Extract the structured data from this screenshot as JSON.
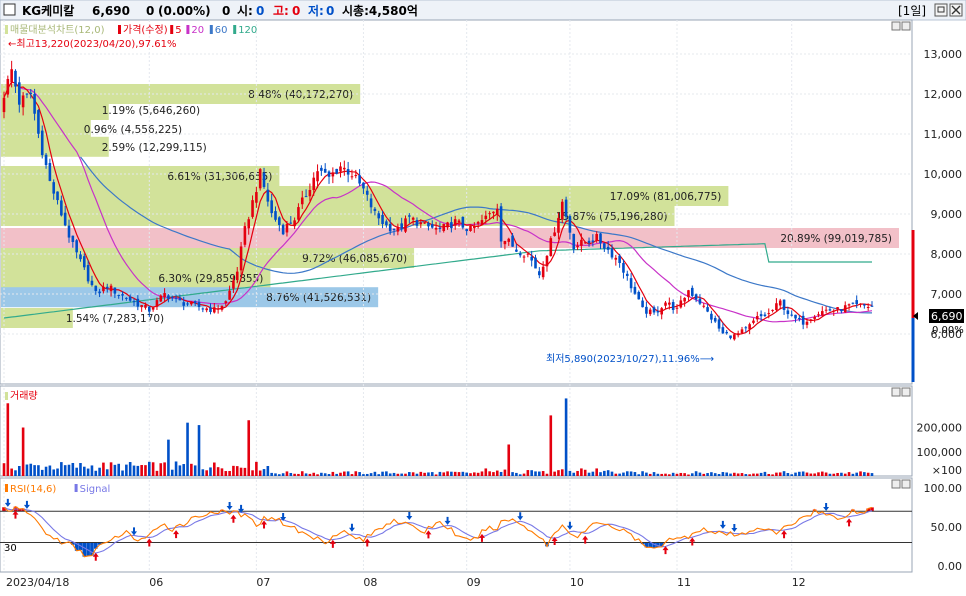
{
  "header": {
    "name": "KG케미칼",
    "price": "6,690",
    "change": "0",
    "change_pct": "(0.00%)",
    "volume": "0",
    "open_label": "시:",
    "open_val": "0",
    "high_label": "고:",
    "high_val": "0",
    "low_label": "저:",
    "low_val": "0",
    "mcap": "시총:4,580억",
    "period": "[1일]"
  },
  "colors": {
    "up": "#e4000f",
    "down": "#0050c8",
    "ma5": "#e4000f",
    "ma20": "#c832c8",
    "ma60": "#3c78c8",
    "ma120": "#32aa8c",
    "rsi": "#ff7a00",
    "signal": "#7878e6",
    "band_green": "#d2e29a",
    "band_pink": "#f2c0c8",
    "band_blue": "#9cc8e8"
  },
  "legends": {
    "price": [
      {
        "text": "매물대분석차트(12,0)",
        "color": "#d2e29a"
      },
      {
        "text": "가격(수정)",
        "color": "#e4000f"
      },
      {
        "text": "5",
        "color": "#e4000f"
      },
      {
        "text": "20",
        "color": "#c832c8"
      },
      {
        "text": "60",
        "color": "#3c78c8"
      },
      {
        "text": "120",
        "color": "#32aa8c"
      }
    ],
    "volume": "거래량",
    "rsi": [
      {
        "text": "RSI(14,6)",
        "color": "#ff7a00"
      },
      {
        "text": "Signal",
        "color": "#7878e6"
      }
    ]
  },
  "annotations": {
    "high": "최고13,220(2023/04/20),97.61%",
    "low": "최저5,890(2023/10/27),11.96%",
    "rsi_level": "30",
    "current_price": "6,690",
    "current_pct": "0.00%"
  },
  "chart_data": [
    {
      "type": "candlestick",
      "title": "",
      "ylim": [
        4800,
        13800
      ],
      "y_ticks": [
        "13,000",
        "12,000",
        "11,000",
        "10,000",
        "9,000",
        "8,000",
        "7,000",
        "6,000"
      ],
      "x_tick_labels": [
        "2023/04/18",
        "06",
        "07",
        "08",
        "09",
        "10",
        "11",
        "12"
      ],
      "ohlc_anchors": [
        [
          0,
          12000
        ],
        [
          2,
          12600
        ],
        [
          4,
          11800
        ],
        [
          7,
          12000
        ],
        [
          9,
          11000
        ],
        [
          12,
          9800
        ],
        [
          15,
          9000
        ],
        [
          18,
          8200
        ],
        [
          21,
          7600
        ],
        [
          24,
          7000
        ],
        [
          27,
          7200
        ],
        [
          30,
          7000
        ],
        [
          34,
          6800
        ],
        [
          38,
          6600
        ],
        [
          42,
          7000
        ],
        [
          46,
          6800
        ],
        [
          50,
          6700
        ],
        [
          55,
          6600
        ],
        [
          58,
          6800
        ],
        [
          61,
          7600
        ],
        [
          63,
          8600
        ],
        [
          65,
          9300
        ],
        [
          67,
          10000
        ],
        [
          70,
          9000
        ],
        [
          73,
          8600
        ],
        [
          76,
          8900
        ],
        [
          79,
          9500
        ],
        [
          82,
          10100
        ],
        [
          85,
          9900
        ],
        [
          88,
          10200
        ],
        [
          91,
          10000
        ],
        [
          94,
          9600
        ],
        [
          97,
          9000
        ],
        [
          100,
          8700
        ],
        [
          103,
          8600
        ],
        [
          106,
          8900
        ],
        [
          110,
          8700
        ],
        [
          114,
          8600
        ],
        [
          118,
          8800
        ],
        [
          122,
          8600
        ],
        [
          126,
          8900
        ],
        [
          129,
          9200
        ],
        [
          130,
          8400
        ],
        [
          132,
          8300
        ],
        [
          134,
          8100
        ],
        [
          137,
          8000
        ],
        [
          140,
          7500
        ],
        [
          143,
          8300
        ],
        [
          146,
          9300
        ],
        [
          149,
          8200
        ],
        [
          152,
          8300
        ],
        [
          155,
          8400
        ],
        [
          158,
          8100
        ],
        [
          161,
          7800
        ],
        [
          164,
          7200
        ],
        [
          167,
          6600
        ],
        [
          170,
          6500
        ],
        [
          173,
          6800
        ],
        [
          176,
          6600
        ],
        [
          179,
          7100
        ],
        [
          182,
          6800
        ],
        [
          185,
          6400
        ],
        [
          188,
          6000
        ],
        [
          191,
          5950
        ],
        [
          194,
          6100
        ],
        [
          197,
          6400
        ],
        [
          200,
          6500
        ],
        [
          203,
          6800
        ],
        [
          206,
          6400
        ],
        [
          209,
          6300
        ],
        [
          212,
          6500
        ],
        [
          215,
          6600
        ],
        [
          218,
          6600
        ],
        [
          221,
          6700
        ],
        [
          224,
          6700
        ],
        [
          227,
          6690
        ]
      ],
      "volume_ticks": [
        "200,000",
        "100,000",
        "×100"
      ],
      "volume_notable_spikes": [
        [
          1,
          300000
        ],
        [
          5,
          200000
        ],
        [
          43,
          150000
        ],
        [
          48,
          220000
        ],
        [
          51,
          210000
        ],
        [
          64,
          230000
        ],
        [
          132,
          130000
        ],
        [
          143,
          250000
        ],
        [
          147,
          320000
        ]
      ],
      "rsi_ticks": [
        "100.00",
        "50.00",
        "0.00"
      ],
      "rsi_anchors": [
        [
          0,
          74
        ],
        [
          3,
          72
        ],
        [
          6,
          70
        ],
        [
          8,
          60
        ],
        [
          10,
          48
        ],
        [
          12,
          38
        ],
        [
          14,
          33
        ],
        [
          16,
          30
        ],
        [
          18,
          25
        ],
        [
          20,
          17
        ],
        [
          22,
          12
        ],
        [
          24,
          22
        ],
        [
          26,
          28
        ],
        [
          28,
          30
        ],
        [
          30,
          40
        ],
        [
          32,
          42
        ],
        [
          34,
          36
        ],
        [
          36,
          34
        ],
        [
          38,
          40
        ],
        [
          40,
          45
        ],
        [
          42,
          52
        ],
        [
          44,
          48
        ],
        [
          46,
          53
        ],
        [
          48,
          57
        ],
        [
          50,
          62
        ],
        [
          52,
          66
        ],
        [
          54,
          69
        ],
        [
          56,
          70
        ],
        [
          58,
          66
        ],
        [
          60,
          70
        ],
        [
          62,
          66
        ],
        [
          64,
          60
        ],
        [
          66,
          54
        ],
        [
          68,
          60
        ],
        [
          70,
          64
        ],
        [
          72,
          58
        ],
        [
          74,
          53
        ],
        [
          76,
          48
        ],
        [
          78,
          42
        ],
        [
          80,
          38
        ],
        [
          82,
          35
        ],
        [
          84,
          32
        ],
        [
          86,
          38
        ],
        [
          88,
          46
        ],
        [
          90,
          40
        ],
        [
          92,
          36
        ],
        [
          94,
          34
        ],
        [
          96,
          40
        ],
        [
          98,
          48
        ],
        [
          100,
          54
        ],
        [
          102,
          60
        ],
        [
          104,
          56
        ],
        [
          106,
          50
        ],
        [
          108,
          48
        ],
        [
          110,
          44
        ],
        [
          112,
          52
        ],
        [
          114,
          56
        ],
        [
          116,
          50
        ],
        [
          118,
          42
        ],
        [
          120,
          34
        ],
        [
          122,
          30
        ],
        [
          124,
          38
        ],
        [
          126,
          48
        ],
        [
          128,
          46
        ],
        [
          130,
          55
        ],
        [
          132,
          60
        ],
        [
          134,
          57
        ],
        [
          136,
          51
        ],
        [
          138,
          46
        ],
        [
          140,
          37
        ],
        [
          142,
          28
        ],
        [
          144,
          42
        ],
        [
          146,
          52
        ],
        [
          148,
          45
        ],
        [
          150,
          36
        ],
        [
          152,
          45
        ],
        [
          154,
          52
        ],
        [
          156,
          56
        ],
        [
          158,
          54
        ],
        [
          160,
          48
        ],
        [
          162,
          44
        ],
        [
          164,
          40
        ],
        [
          166,
          31
        ],
        [
          168,
          24
        ],
        [
          170,
          20
        ],
        [
          172,
          28
        ],
        [
          174,
          37
        ],
        [
          176,
          34
        ],
        [
          178,
          36
        ],
        [
          180,
          42
        ],
        [
          182,
          48
        ],
        [
          184,
          46
        ],
        [
          186,
          40
        ],
        [
          188,
          42
        ],
        [
          190,
          40
        ],
        [
          192,
          38
        ],
        [
          194,
          42
        ],
        [
          196,
          48
        ],
        [
          198,
          50
        ],
        [
          200,
          44
        ],
        [
          202,
          42
        ],
        [
          204,
          48
        ],
        [
          206,
          54
        ],
        [
          208,
          60
        ],
        [
          210,
          66
        ],
        [
          212,
          70
        ],
        [
          214,
          68
        ],
        [
          216,
          64
        ],
        [
          218,
          60
        ],
        [
          220,
          66
        ],
        [
          222,
          70
        ],
        [
          224,
          68
        ],
        [
          226,
          72
        ],
        [
          227,
          74
        ]
      ]
    }
  ],
  "volume_bands": [
    {
      "label": "8.48% (40,172,270)",
      "price": 12000,
      "width_frac": 0.4,
      "color": "green"
    },
    {
      "label": "1.19% (5,646,260)",
      "price": 11600,
      "width_frac": 0.12,
      "color": "green"
    },
    {
      "label": "0.96% (4,556,225)",
      "price": 11120,
      "width_frac": 0.1,
      "color": "green"
    },
    {
      "label": "2.59% (12,299,115)",
      "price": 10680,
      "width_frac": 0.12,
      "color": "green"
    },
    {
      "label": "6.61% (31,306,655)",
      "price": 9950,
      "width_frac": 0.31,
      "color": "green"
    },
    {
      "label": "17.09% (81,006,775)",
      "price": 9450,
      "width_frac": 0.81,
      "color": "green"
    },
    {
      "label": "15.87% (75,196,280)",
      "price": 8950,
      "width_frac": 0.75,
      "color": "green"
    },
    {
      "label": "20.89% (99,019,785)",
      "price": 8400,
      "width_frac": 1.0,
      "color": "pink"
    },
    {
      "label": "9.72% (46,085,670)",
      "price": 7900,
      "width_frac": 0.46,
      "color": "green"
    },
    {
      "label": "6.30% (29,859,855)",
      "price": 7400,
      "width_frac": 0.3,
      "color": "green"
    },
    {
      "label": "8.76% (41,526,531)",
      "price": 6920,
      "width_frac": 0.42,
      "color": "blue"
    },
    {
      "label": "1.54% (7,283,170)",
      "price": 6400,
      "width_frac": 0.08,
      "color": "green"
    }
  ]
}
